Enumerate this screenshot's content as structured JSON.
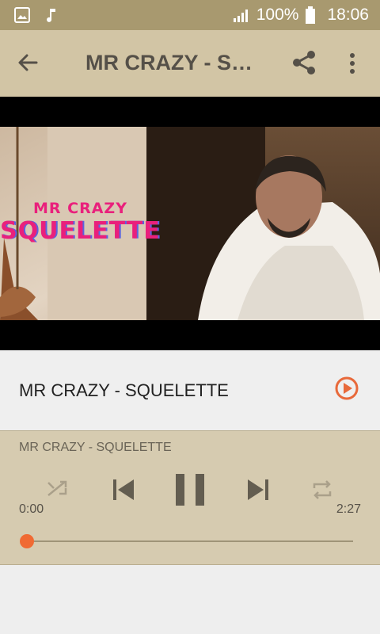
{
  "status": {
    "battery": "100%",
    "time": "18:06"
  },
  "toolbar": {
    "title": "MR CRAZY - SQUELETTE"
  },
  "thumbnail": {
    "overlay_line1": "MR CRAZY",
    "overlay_line2": "SQUELETTE"
  },
  "song": {
    "name": "MR CRAZY - SQUELETTE"
  },
  "player": {
    "track": "MR CRAZY - SQUELETTE",
    "elapsed": "0:00",
    "duration": "2:27",
    "progress": 0.0
  },
  "colors": {
    "status_bar": "#a8996f",
    "toolbar": "#d2c5a5",
    "player": "#d6cbb0",
    "accent": "#f06a33"
  }
}
